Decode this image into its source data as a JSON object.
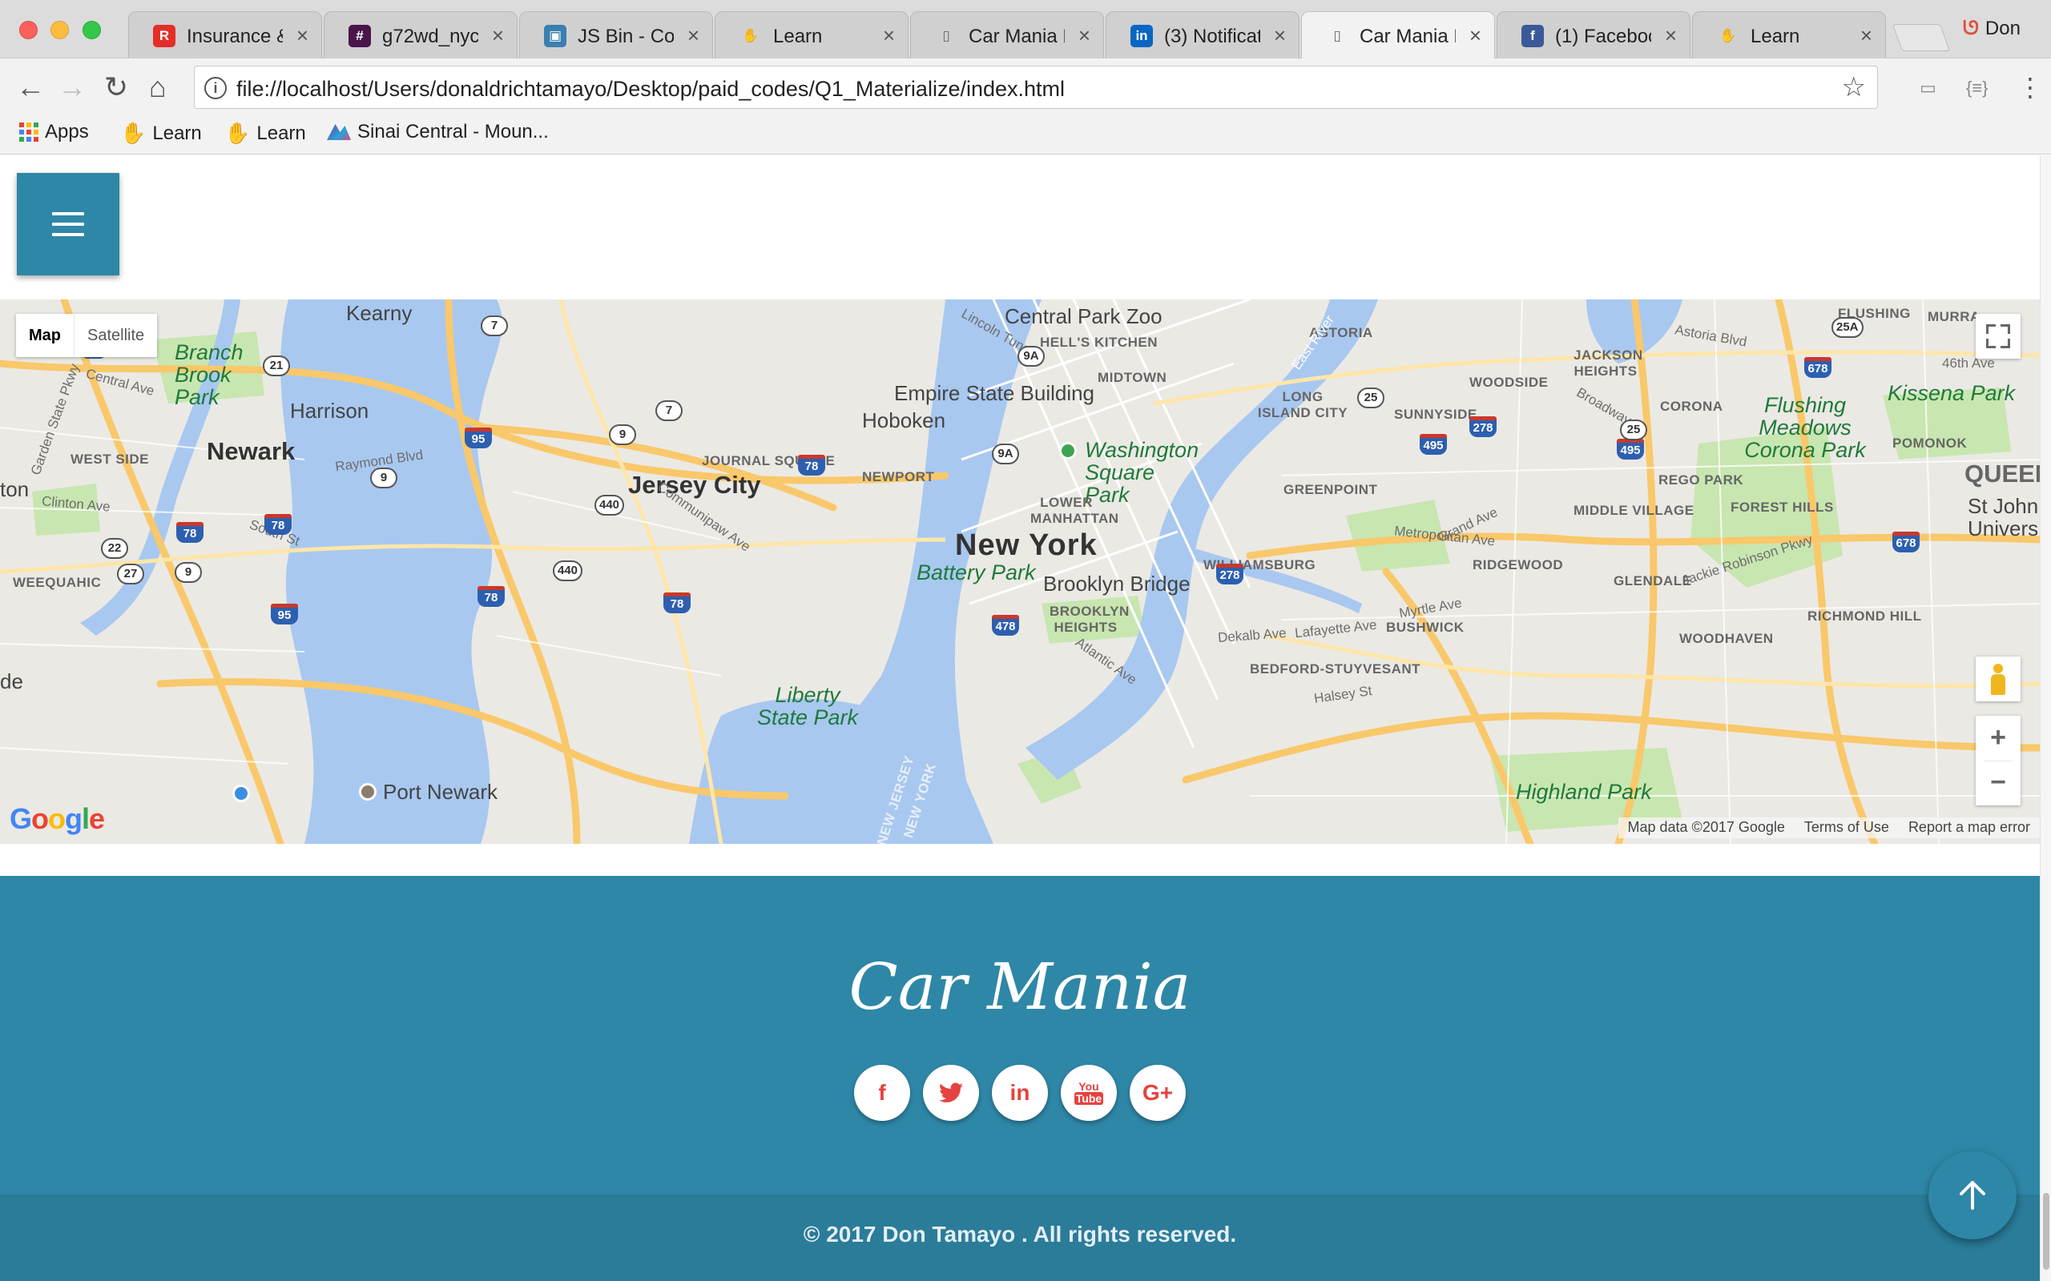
{
  "browser": {
    "tabs": [
      {
        "title": "Insurance &",
        "icon": "rayban-icon",
        "color": "#e52d27",
        "glyph": "R"
      },
      {
        "title": "g72wd_nyc",
        "icon": "slack-hash-icon",
        "color": "#4a154b",
        "glyph": "#"
      },
      {
        "title": "JS Bin - Col",
        "icon": "jsbin-icon",
        "color": "#3a7fb0",
        "glyph": "▣"
      },
      {
        "title": "Learn",
        "icon": "learn-hand-icon",
        "color": "#e8973a",
        "glyph": "✋"
      },
      {
        "title": "Car Mania B",
        "icon": "document-icon",
        "color": "#888888",
        "glyph": "▯"
      },
      {
        "title": "(3) Notificat",
        "icon": "linkedin-icon",
        "color": "#0a66c2",
        "glyph": "in"
      },
      {
        "title": "Car Mania B",
        "icon": "document-icon",
        "color": "#888888",
        "glyph": "▯",
        "active": true
      },
      {
        "title": "(1) Faceboo",
        "icon": "facebook-icon",
        "color": "#3b5998",
        "glyph": "f"
      },
      {
        "title": "Learn",
        "icon": "learn-hand-icon",
        "color": "#e8973a",
        "glyph": "✋"
      }
    ],
    "profile_name": "Don",
    "url": "file://localhost/Users/donaldrichtamayo/Desktop/paid_codes/Q1_Materialize/index.html",
    "bookmarks": [
      {
        "label": "Apps",
        "icon": "apps-grid-icon"
      },
      {
        "label": "Learn",
        "icon": "learn-hand-icon"
      },
      {
        "label": "Learn",
        "icon": "learn-hand-icon"
      },
      {
        "label": "Sinai Central - Moun...",
        "icon": "sinai-logo-icon"
      }
    ]
  },
  "map": {
    "type_options": [
      "Map",
      "Satellite"
    ],
    "selected_type": "Map",
    "labels": {
      "kearny": "Kearny",
      "branch_brook_park": "Branch Brook Park",
      "harrison": "Harrison",
      "newark": "Newark",
      "west_side": "WEST SIDE",
      "ton": "ton",
      "weequahic": "WEEQUAHIC",
      "de": "de",
      "port_newark": "Port Newark",
      "jersey_city": "Jersey City",
      "journal_square": "JOURNAL SQUARE",
      "newport": "NEWPORT",
      "liberty_state_park": "Liberty State Park",
      "hoboken": "Hoboken",
      "empire_state_building": "Empire State Building",
      "central_park_zoo": "Central Park Zoo",
      "hells_kitchen": "HELL'S KITCHEN",
      "midtown": "MIDTOWN",
      "washington_square_park": "Washington Square Park",
      "lower_manhattan": "LOWER MANHATTAN",
      "new_york": "New York",
      "battery_park": "Battery Park",
      "brooklyn_bridge": "Brooklyn Bridge",
      "brooklyn_heights": "BROOKLYN HEIGHTS",
      "astoria": "ASTORIA",
      "long_island_city": "LONG ISLAND CITY",
      "sunnyside": "SUNNYSIDE",
      "woodside": "WOODSIDE",
      "jackson_heights": "JACKSON HEIGHTS",
      "corona": "CORONA",
      "greenpoint": "GREENPOINT",
      "williamsburg": "WILLIAMSBURG",
      "ridgewood": "RIDGEWOOD",
      "bushwick": "BUSHWICK",
      "bedford_stuyvesant": "BEDFORD-STUYVESANT",
      "middle_village": "MIDDLE VILLAGE",
      "rego_park": "REGO PARK",
      "forest_hills": "FOREST HILLS",
      "glendale": "GLENDALE",
      "richmond_hill": "RICHMOND HILL",
      "woodhaven": "WOODHAVEN",
      "flushing": "FLUSHING",
      "murra": "MURRA",
      "flushing_meadows_corona_park": "Flushing Meadows Corona Park",
      "kissena_park": "Kissena Park",
      "pomonok": "POMONOK",
      "queen": "QUEEN",
      "st_john_univers": "St John Univers",
      "highland_park": "Highland Park",
      "new_jersey": "NEW JERSEY",
      "new_york_water": "NEW YORK",
      "east_river": "East River",
      "lincoln_tunnel": "Lincoln Tunnel",
      "jackie_robinson_pkwy": "Jackie Robinson Pkwy",
      "raymond_blvd": "Raymond Blvd",
      "communipaw_ave": "Communipaw Ave",
      "grand_ave": "Grand Ave",
      "metropolitan_ave": "Metropolitan Ave",
      "myrtle_ave": "Myrtle Ave",
      "astoria_blvd": "Astoria Blvd",
      "broadway": "Broadway",
      "central_ave": "Central Ave",
      "clinton_ave": "Clinton Ave",
      "south_st": "South St",
      "garden_state_pkwy": "Garden State Pkwy",
      "atlantic_ave": "Atlantic Ave",
      "dekalb_ave": "Dekalb Ave",
      "lafayette_ave": "Lafayette Ave",
      "halsey_st": "Halsey St",
      "ave_46th": "46th Ave"
    },
    "highways": [
      "280",
      "21",
      "7",
      "7",
      "9",
      "95",
      "78",
      "9",
      "78",
      "22",
      "27",
      "9",
      "78",
      "95",
      "440",
      "440",
      "78",
      "9A",
      "9A",
      "78",
      "478",
      "278",
      "495",
      "278",
      "495",
      "25",
      "25",
      "25A",
      "678",
      "678"
    ],
    "attribution": [
      "Map data ©2017 Google",
      "Terms of Use",
      "Report a map error"
    ],
    "google_logo": "Google"
  },
  "footer": {
    "title": "Car Mania",
    "socials": [
      {
        "name": "facebook",
        "glyph": "f"
      },
      {
        "name": "twitter",
        "glyph": "🐦"
      },
      {
        "name": "linkedin",
        "glyph": "in"
      },
      {
        "name": "youtube",
        "glyph": "You Tube"
      },
      {
        "name": "google-plus",
        "glyph": "G+"
      }
    ],
    "copyright": "© 2017 Don Tamayo . All rights reserved."
  },
  "colors": {
    "brand": "#2e87a7",
    "social_icon": "#e5433f",
    "water": "#a8c8f0",
    "park": "#c8e6b0",
    "road": "#f9c86a"
  }
}
